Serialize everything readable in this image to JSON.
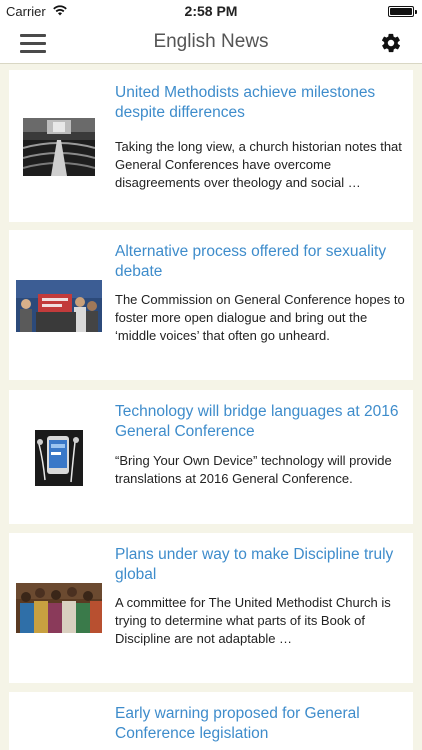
{
  "status_bar": {
    "carrier": "Carrier",
    "time": "2:58 PM",
    "battery_level": 1.0
  },
  "nav": {
    "title": "English News",
    "menu_icon": "hamburger-menu-icon",
    "settings_icon": "gear-icon"
  },
  "colors": {
    "background": "#f5f4e7",
    "card": "#ffffff",
    "headline": "#3e8ccb",
    "body_text": "#222222"
  },
  "articles": [
    {
      "headline": "United Methodists achieve milestones despite differences",
      "summary": "Taking the long view, a church historian notes that General Conferences have overcome disagreements over theology and social …",
      "thumbnail": "black-and-white conference hall photo"
    },
    {
      "headline": "Alternative process offered for sexuality debate",
      "summary": "The Commission on General Conference hopes to foster more open dialogue and bring out the ‘middle voices’ that often go unheard.",
      "thumbnail": "protest group with banner photo"
    },
    {
      "headline": "Technology will bridge languages at 2016 General Conference",
      "summary": "“Bring Your Own Device” technology will provide translations at 2016 General Conference.",
      "thumbnail": "smartphone with earbuds photo"
    },
    {
      "headline": "Plans under way to make Discipline truly global",
      "summary": "A committee for The United Methodist Church is trying to determine what parts of its Book of Discipline are not adaptable …",
      "thumbnail": "crowd worship photo"
    },
    {
      "headline": "Early warning proposed for General Conference legislation",
      "summary": "",
      "thumbnail": "blank"
    }
  ]
}
